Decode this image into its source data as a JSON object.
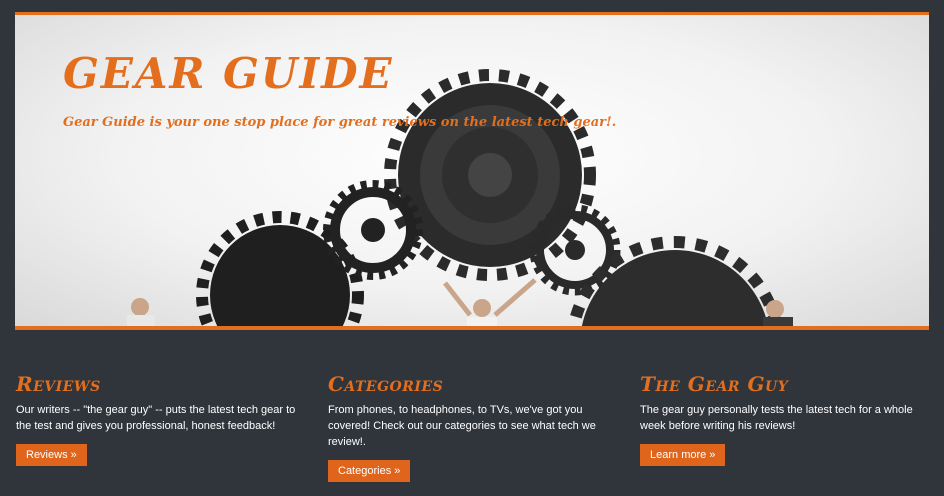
{
  "hero": {
    "title": "Gear Guide",
    "tagline": "Gear Guide is your one stop place for great reviews on the latest tech gear!."
  },
  "columns": [
    {
      "heading": "Reviews",
      "text": "Our writers -- \"the gear guy\" -- puts the latest tech gear to the test and gives you professional, honest feedback!",
      "button": "Reviews »"
    },
    {
      "heading": "Categories",
      "text": "From phones, to headphones, to TVs, we've got you covered! Check out our categories to see what tech we review!.",
      "button": "Categories »"
    },
    {
      "heading": "The Gear Guy",
      "text": "The gear guy personally tests the latest tech for a whole week before writing his reviews!",
      "button": "Learn more »"
    }
  ],
  "colors": {
    "accent": "#e36f1e",
    "background": "#30343b"
  }
}
